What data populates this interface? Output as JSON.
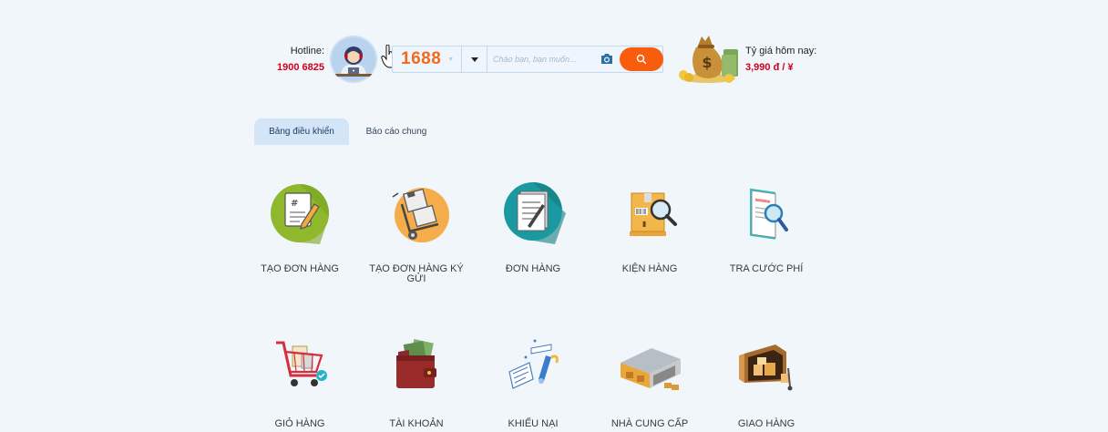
{
  "header": {
    "hotline_label": "Hotline:",
    "hotline_number": "1900 6825",
    "site_select": "1688",
    "search_placeholder": "Chào bạn, bạn muốn...",
    "rate_label": "Tỷ giá hôm nay:",
    "rate_value": "3,990 đ / ¥"
  },
  "tabs": [
    {
      "label": "Bảng điều khiển",
      "active": true
    },
    {
      "label": "Báo cáo chung",
      "active": false
    }
  ],
  "tiles": [
    {
      "label": "TẠO ĐƠN HÀNG",
      "icon": "create-order-icon"
    },
    {
      "label": "TẠO ĐƠN HÀNG KÝ GỬI",
      "icon": "consignment-order-icon"
    },
    {
      "label": "ĐƠN HÀNG",
      "icon": "orders-icon"
    },
    {
      "label": "KIỆN HÀNG",
      "icon": "package-icon"
    },
    {
      "label": "TRA CƯỚC PHÍ",
      "icon": "fee-lookup-icon"
    },
    {
      "label": "GIỎ HÀNG",
      "icon": "cart-icon"
    },
    {
      "label": "TÀI KHOẢN",
      "icon": "wallet-icon"
    },
    {
      "label": "KHIẾU NẠI",
      "icon": "complaint-icon"
    },
    {
      "label": "NHÀ CUNG CẤP",
      "icon": "supplier-icon"
    },
    {
      "label": "GIAO HÀNG",
      "icon": "delivery-icon"
    }
  ],
  "colors": {
    "background": "#f1f6fb",
    "accent_orange": "#f75d0c",
    "price_red": "#d0021b",
    "active_tab": "#d3e5f6"
  }
}
